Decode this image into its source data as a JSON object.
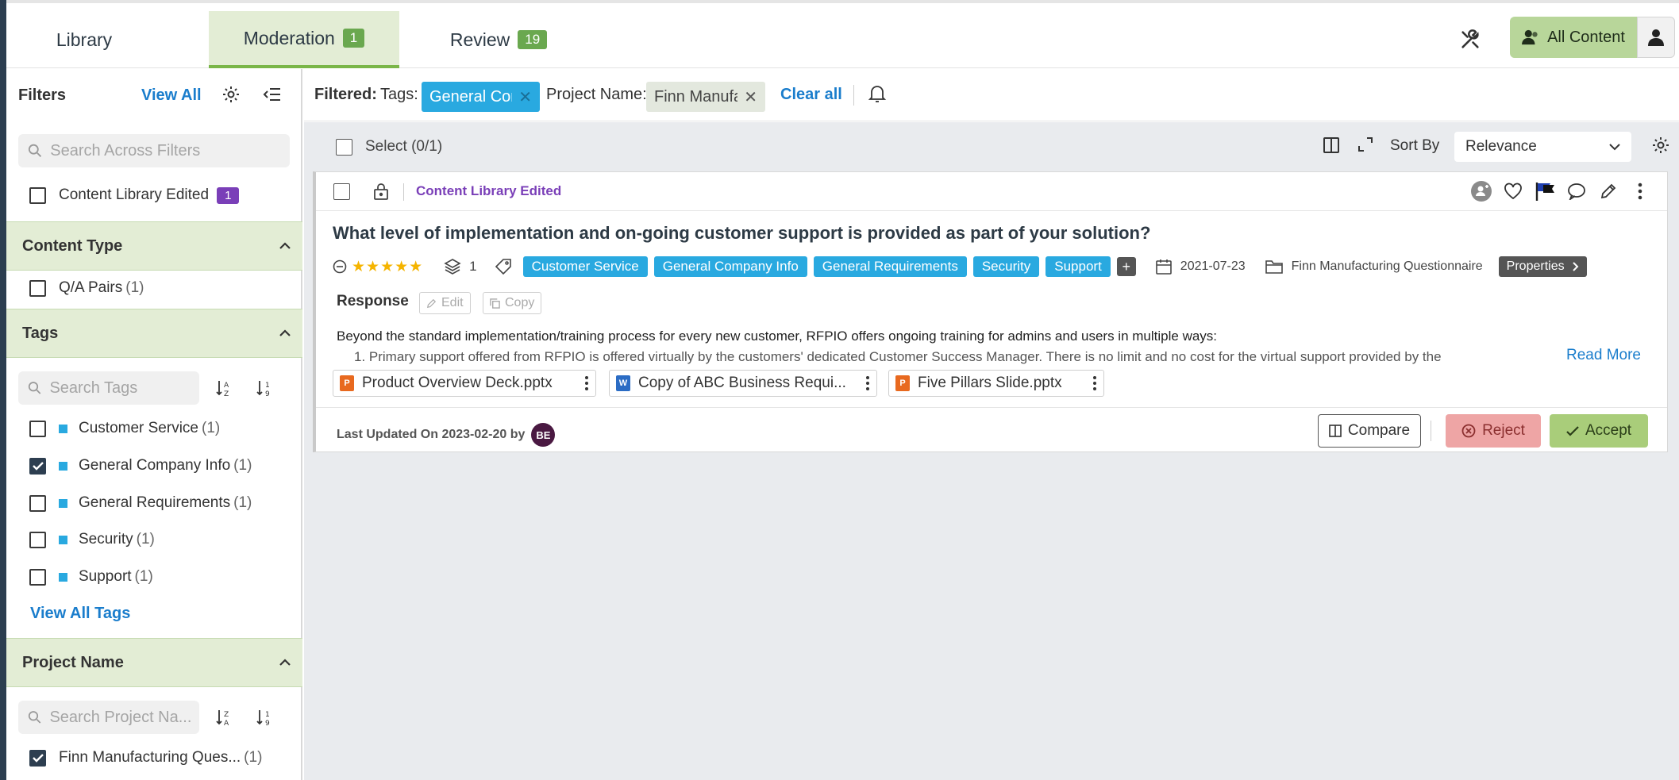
{
  "header": {
    "tabs": [
      {
        "label": "Library",
        "count": ""
      },
      {
        "label": "Moderation",
        "count": "1"
      },
      {
        "label": "Review",
        "count": "19"
      }
    ],
    "all_content_label": "All Content"
  },
  "sidebar": {
    "title": "Filters",
    "view_all": "View All",
    "search_placeholder": "Search Across Filters",
    "content_library_edited": {
      "label": "Content Library Edited",
      "count": "1"
    },
    "content_type": {
      "title": "Content Type",
      "items": [
        {
          "label": "Q/A Pairs",
          "count": "(1)",
          "checked": false
        }
      ]
    },
    "tags": {
      "title": "Tags",
      "search_placeholder": "Search Tags",
      "items": [
        {
          "label": "Customer Service",
          "count": "(1)",
          "checked": false
        },
        {
          "label": "General Company Info",
          "count": "(1)",
          "checked": true
        },
        {
          "label": "General Requirements",
          "count": "(1)",
          "checked": false
        },
        {
          "label": "Security",
          "count": "(1)",
          "checked": false
        },
        {
          "label": "Support",
          "count": "(1)",
          "checked": false
        }
      ],
      "view_all": "View All Tags"
    },
    "project_name": {
      "title": "Project Name",
      "search_placeholder": "Search Project Na...",
      "items": [
        {
          "label": "Finn Manufacturing Ques...",
          "count": "(1)",
          "checked": true
        }
      ]
    }
  },
  "filterbar": {
    "filtered_label": "Filtered:",
    "tags_label": "Tags:",
    "tags_chip": "General Con",
    "project_label": "Project Name:",
    "project_chip": "Finn Manufa",
    "clear_all": "Clear all"
  },
  "toolbar": {
    "select_label": "Select (0/1)",
    "sort_by_label": "Sort By",
    "sort_value": "Relevance"
  },
  "card": {
    "status": "Content Library Edited",
    "question": "What level of implementation and on-going customer support is provided as part of your solution?",
    "version_count": "1",
    "tags": [
      "Customer Service",
      "General Company Info",
      "General Requirements",
      "Security",
      "Support"
    ],
    "date": "2021-07-23",
    "project": "Finn Manufacturing Questionnaire",
    "properties_label": "Properties",
    "response_label": "Response",
    "edit_label": "Edit",
    "copy_label": "Copy",
    "response_line1": "Beyond the standard implementation/training process for every new customer, RFPIO offers ongoing training for admins and users in multiple ways:",
    "response_line2": "1. Primary support offered from RFPIO is offered virtually by the customers' dedicated Customer Success Manager. There is no limit and no cost for the virtual support provided by the",
    "read_more": "Read More",
    "attachments": [
      {
        "name": "Product Overview Deck.pptx",
        "icon": "pptx-icon"
      },
      {
        "name": "Copy of ABC Business Requi...",
        "icon": "docx-icon"
      },
      {
        "name": "Five Pillars Slide.pptx",
        "icon": "pptx-icon"
      }
    ],
    "last_updated": "Last Updated On 2023-02-20 by",
    "avatar_initials": "BE",
    "compare_label": "Compare",
    "reject_label": "Reject",
    "accept_label": "Accept"
  },
  "colors": {
    "accent_green": "#7ab648",
    "tag_blue": "#29a9e0",
    "purple": "#7a3fb8",
    "link_blue": "#1a7dcc"
  }
}
